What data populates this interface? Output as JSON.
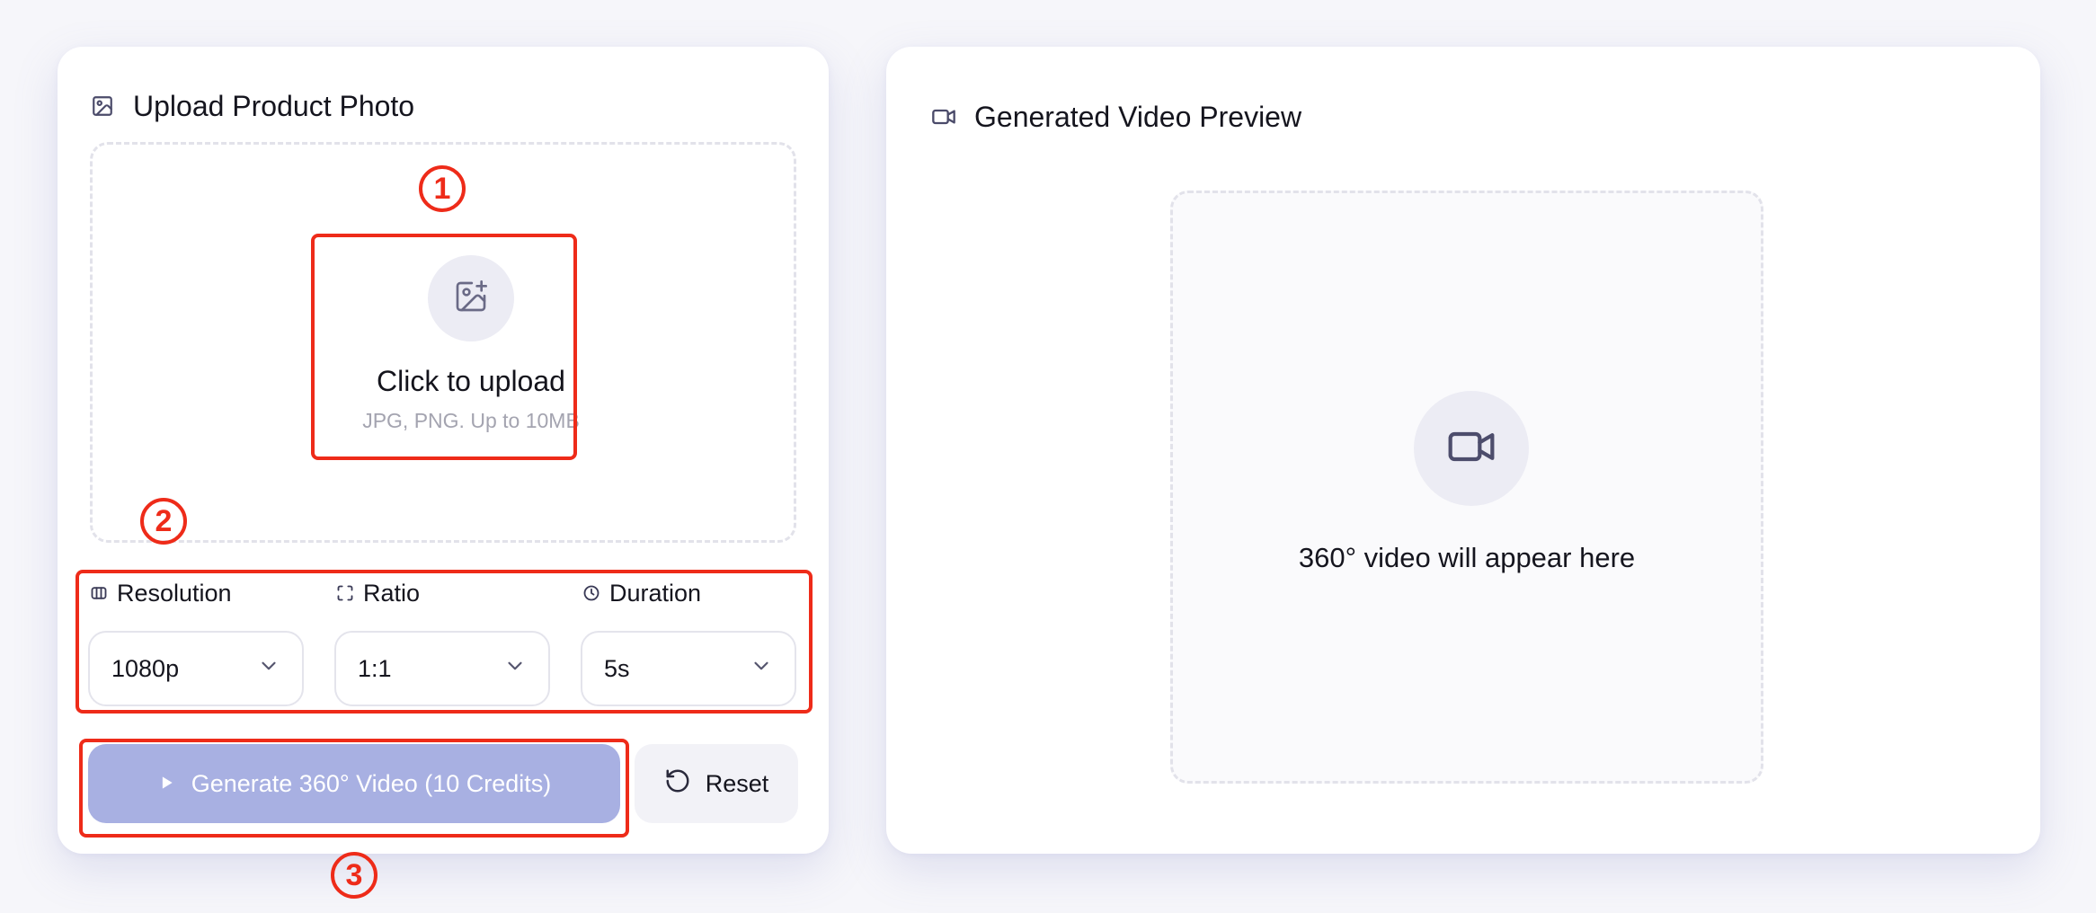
{
  "upload_panel": {
    "title": "Upload Product Photo",
    "header_icon": "image-icon",
    "dropzone": {
      "icon": "image-plus-icon",
      "title": "Click to upload",
      "hint": "JPG, PNG. Up to 10MB"
    }
  },
  "settings": {
    "resolution": {
      "label": "Resolution",
      "icon": "columns-icon",
      "value": "1080p"
    },
    "ratio": {
      "label": "Ratio",
      "icon": "aspect-ratio-icon",
      "value": "1:1"
    },
    "duration": {
      "label": "Duration",
      "icon": "clock-icon",
      "value": "5s"
    }
  },
  "actions": {
    "generate_label": "Generate 360° Video (10 Credits)",
    "reset_label": "Reset"
  },
  "preview_panel": {
    "title": "Generated Video Preview",
    "header_icon": "video-icon",
    "placeholder": "360° video will appear here"
  },
  "annotations": {
    "step1": "1",
    "step2": "2",
    "step3": "3"
  },
  "colors": {
    "accent_disabled": "#a8b0e2",
    "annotation": "#ee2b19",
    "muted_text": "#a4a4b0",
    "icon_circle": "#ececf4"
  }
}
